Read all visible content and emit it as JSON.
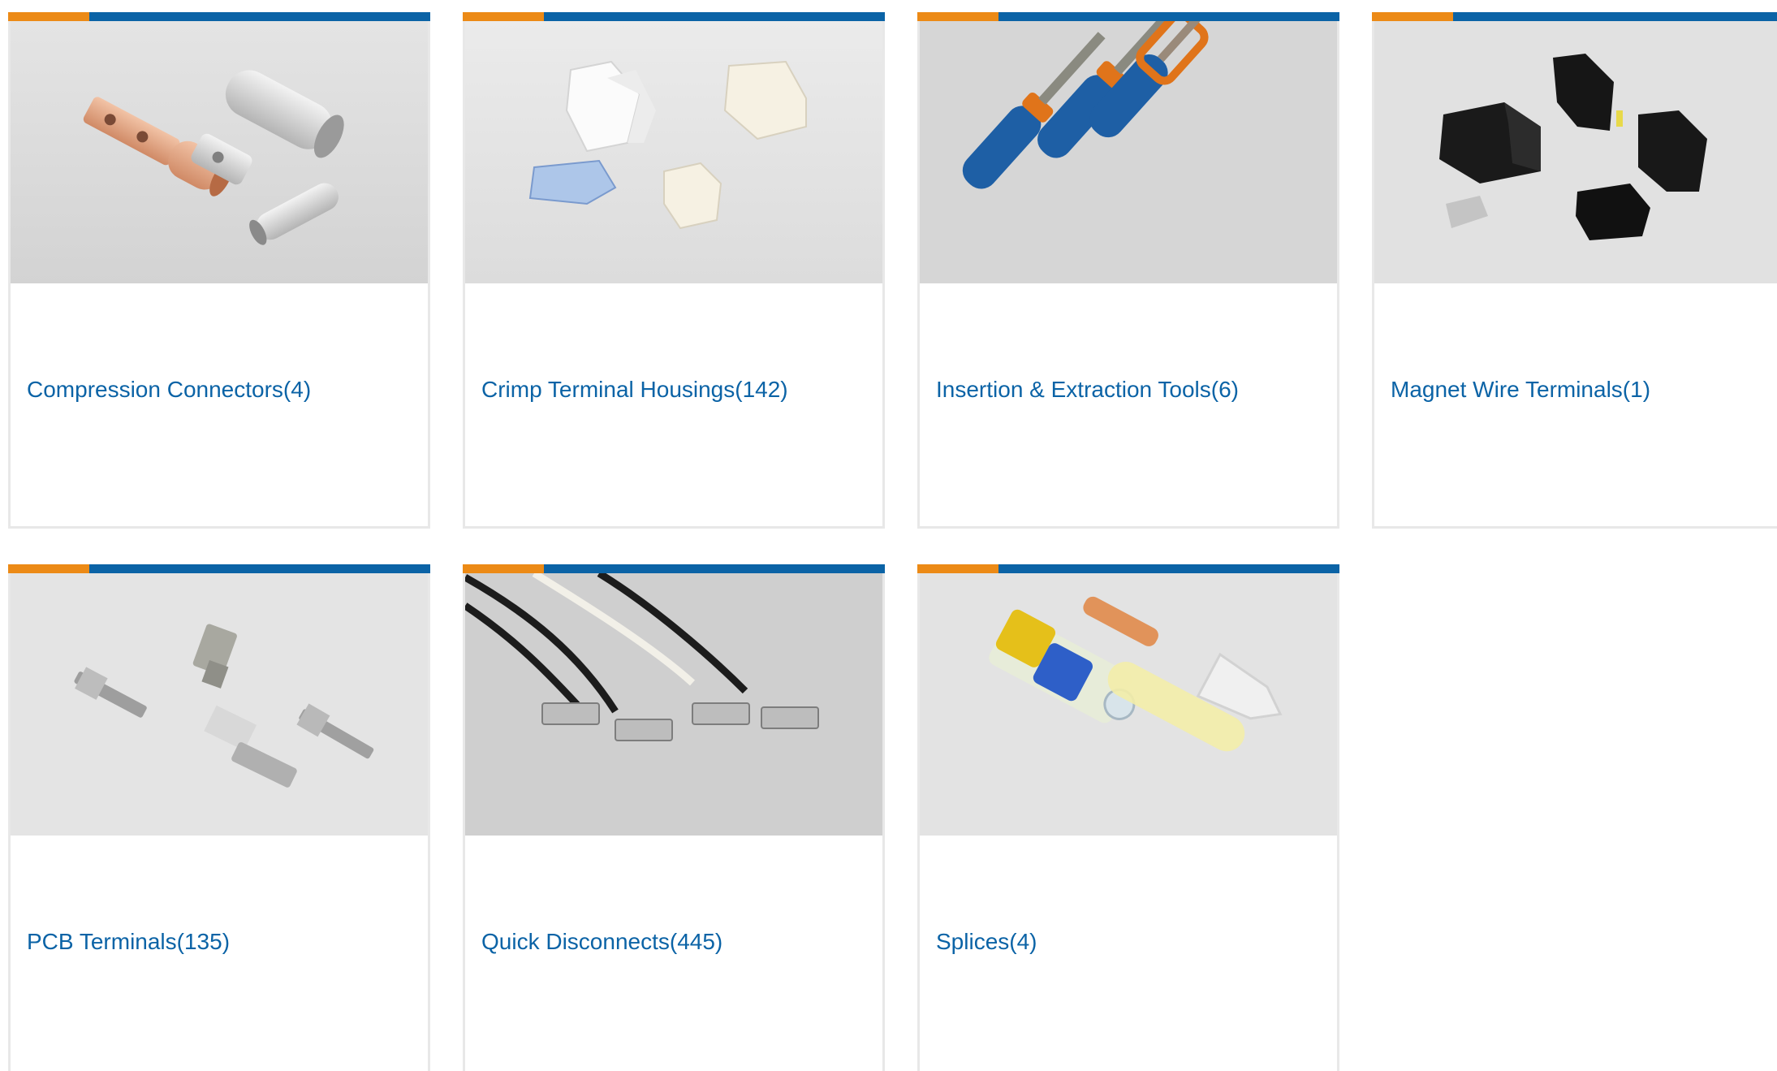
{
  "categories": [
    {
      "name": "Compression Connectors",
      "count": "(4)",
      "image": "compression-connectors-photo"
    },
    {
      "name": "Crimp Terminal Housings",
      "count": "(142)",
      "image": "crimp-terminal-housings-photo"
    },
    {
      "name": "Insertion & Extraction Tools",
      "count": "(6)",
      "image": "insertion-extraction-tools-photo"
    },
    {
      "name": "Magnet Wire Terminals",
      "count": "(1)",
      "image": "magnet-wire-terminals-photo"
    },
    {
      "name": "PCB Terminals",
      "count": "(135)",
      "image": "pcb-terminals-photo"
    },
    {
      "name": "Quick Disconnects",
      "count": "(445)",
      "image": "quick-disconnects-photo"
    },
    {
      "name": "Splices",
      "count": "(4)",
      "image": "splices-photo"
    }
  ],
  "colors": {
    "accent_orange": "#ec8a16",
    "accent_blue": "#0b63a6",
    "link": "#0b63a6",
    "border": "#e8e8e8"
  }
}
